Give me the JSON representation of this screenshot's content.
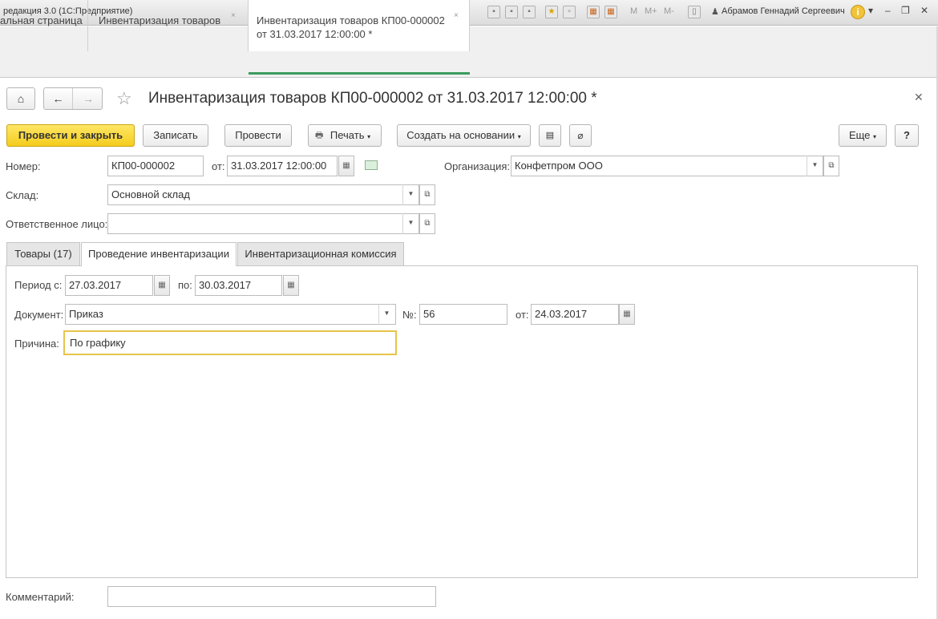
{
  "app": {
    "title": "редакция 3.0  (1С:Предприятие)",
    "user": "Абрамов Геннадий Сергеевич",
    "toolbar_m": [
      "M",
      "M+",
      "M-"
    ]
  },
  "tabs": [
    {
      "label": "альная страница"
    },
    {
      "label": "Инвентаризация товаров"
    },
    {
      "label_line1": "Инвентаризация товаров КП00-000002",
      "label_line2": "от 31.03.2017 12:00:00 *"
    }
  ],
  "form": {
    "title": "Инвентаризация товаров КП00-000002 от 31.03.2017 12:00:00 *"
  },
  "commands": {
    "post_and_close": "Провести и закрыть",
    "save": "Записать",
    "post": "Провести",
    "print": "Печать",
    "create_based_on": "Создать на основании",
    "more": "Еще",
    "help": "?"
  },
  "fields": {
    "number_label": "Номер:",
    "number_value": "КП00-000002",
    "date_label": "от:",
    "date_value": "31.03.2017 12:00:00",
    "organization_label": "Организация:",
    "organization_value": "Конфетпром ООО",
    "warehouse_label": "Склад:",
    "warehouse_value": "Основной склад",
    "responsible_label": "Ответственное лицо:",
    "responsible_value": ""
  },
  "inner_tabs": [
    {
      "label": "Товары (17)"
    },
    {
      "label": "Проведение инвентаризации"
    },
    {
      "label": "Инвентаризационная комиссия"
    }
  ],
  "inventory": {
    "period_from_label": "Период с:",
    "period_from_value": "27.03.2017",
    "period_to_label": "по:",
    "period_to_value": "30.03.2017",
    "document_label": "Документ:",
    "document_value": "Приказ",
    "doc_number_label": "№:",
    "doc_number_value": "56",
    "doc_date_label": "от:",
    "doc_date_value": "24.03.2017",
    "reason_label": "Причина:",
    "reason_value": "По графику"
  },
  "comment": {
    "label": "Комментарий:",
    "value": ""
  }
}
